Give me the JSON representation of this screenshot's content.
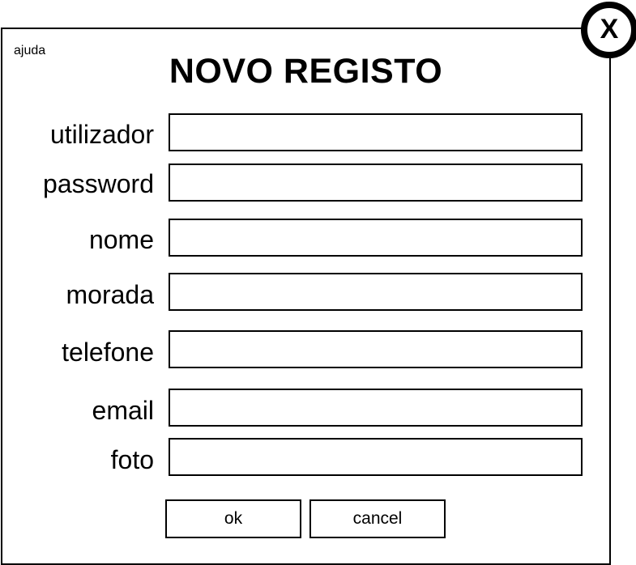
{
  "dialog": {
    "help_label": "ajuda",
    "title": "NOVO REGISTO",
    "close_label": "X"
  },
  "form": {
    "fields": [
      {
        "label": "utilizador",
        "value": ""
      },
      {
        "label": "password",
        "value": ""
      },
      {
        "label": "nome",
        "value": ""
      },
      {
        "label": "morada",
        "value": ""
      },
      {
        "label": "telefone",
        "value": ""
      },
      {
        "label": "email",
        "value": ""
      },
      {
        "label": "foto",
        "value": ""
      }
    ]
  },
  "actions": {
    "ok_label": "ok",
    "cancel_label": "cancel"
  }
}
